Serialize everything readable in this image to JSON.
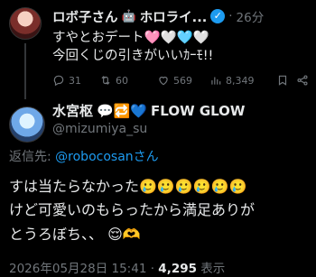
{
  "original_tweet": {
    "author_name": "ロボ子さん",
    "author_emoji": "🤖",
    "author_suffix": "ホロライ...",
    "verified_mark": "✓",
    "time": "26分",
    "line1": "すやとおデート🩷🤍🩵🤍",
    "line2": "今回くじの引きがいいｶｰﾓ!!",
    "actions": {
      "reply_count": "31",
      "retweet_count": "60",
      "like_count": "569",
      "views_count": "8,349"
    }
  },
  "reply": {
    "author_name": "水宮枢",
    "name_emojis": "💬🔁💙",
    "name_suffix": "FLOW GLOW",
    "handle": "@mizumiya_su",
    "reply_to_prefix": "返信先: ",
    "reply_to_mention": "@robocosanさん",
    "text_line1": "すは当たらなかった🥲🥲🥲🥲🥲🥲",
    "text_line2": "けど可愛いのもらったから満足ありが",
    "text_line3": "とうろぼち、、 😌🫶",
    "footer_date": "2026年05月28日 15:41 · ",
    "footer_views": "4,295",
    "footer_views_label": " 表示"
  },
  "colors": {
    "background": "#000000",
    "text": "#e7e9ea",
    "muted": "#71767b",
    "accent": "#1d9bf0"
  },
  "icons": [
    "reply-icon",
    "retweet-icon",
    "like-icon",
    "views-icon",
    "bookmark-icon",
    "share-icon",
    "verified-icon"
  ]
}
